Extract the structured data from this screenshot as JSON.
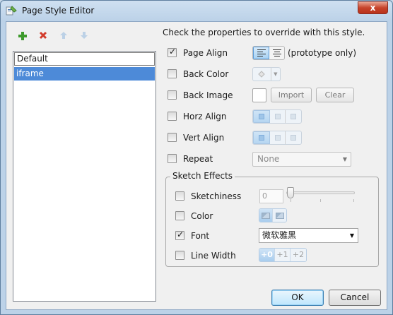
{
  "window": {
    "title": "Page Style Editor",
    "close_label": "x"
  },
  "toolbar": {
    "add_icon": "plus-icon",
    "delete_icon": "x-icon",
    "up_icon": "arrow-up-icon",
    "down_icon": "arrow-down-icon"
  },
  "styles_list": {
    "editing_value": "Default",
    "items": [
      {
        "label": "iframe",
        "selected": true
      }
    ]
  },
  "hint": "Check the properties to override with this style.",
  "properties": {
    "page_align": {
      "label": "Page Align",
      "checked": true,
      "note": "(prototype only)"
    },
    "back_color": {
      "label": "Back Color",
      "checked": false
    },
    "back_image": {
      "label": "Back Image",
      "checked": false,
      "import_label": "Import",
      "clear_label": "Clear"
    },
    "horz_align": {
      "label": "Horz Align",
      "checked": false
    },
    "vert_align": {
      "label": "Vert Align",
      "checked": false
    },
    "repeat": {
      "label": "Repeat",
      "checked": false,
      "value": "None"
    }
  },
  "sketch": {
    "title": "Sketch Effects",
    "sketchiness": {
      "label": "Sketchiness",
      "checked": false,
      "value": "0"
    },
    "color": {
      "label": "Color",
      "checked": false
    },
    "font": {
      "label": "Font",
      "checked": true,
      "value": "微软雅黑"
    },
    "line_width": {
      "label": "Line Width",
      "checked": false,
      "options": [
        "+0",
        "+1",
        "+2"
      ]
    }
  },
  "buttons": {
    "ok": "OK",
    "cancel": "Cancel"
  },
  "colors": {
    "selection": "#4d8ad8",
    "title_bar": "#bcd2e8",
    "close_button": "#c7442c"
  }
}
